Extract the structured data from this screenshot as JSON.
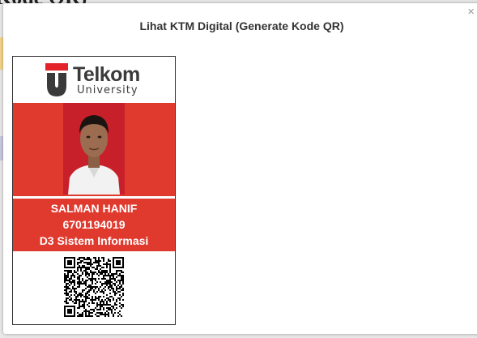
{
  "background": {
    "title_fragment": "Kode QR)"
  },
  "modal": {
    "title": "Lihat KTM Digital (Generate Kode QR)",
    "close_label": "×"
  },
  "card": {
    "logo_main": "Telkom",
    "logo_sub": "University",
    "name": "SALMAN HANIF",
    "nim": "6701194019",
    "program": "D3 Sistem Informasi"
  },
  "colors": {
    "card_red": "#e03a2f",
    "photo_red": "#c8202a",
    "logo_red": "#e32229",
    "logo_gray": "#3a3a3a"
  },
  "icons": {
    "close": "close-icon",
    "logo": "telkom-university-logo",
    "qr": "qr-code"
  }
}
